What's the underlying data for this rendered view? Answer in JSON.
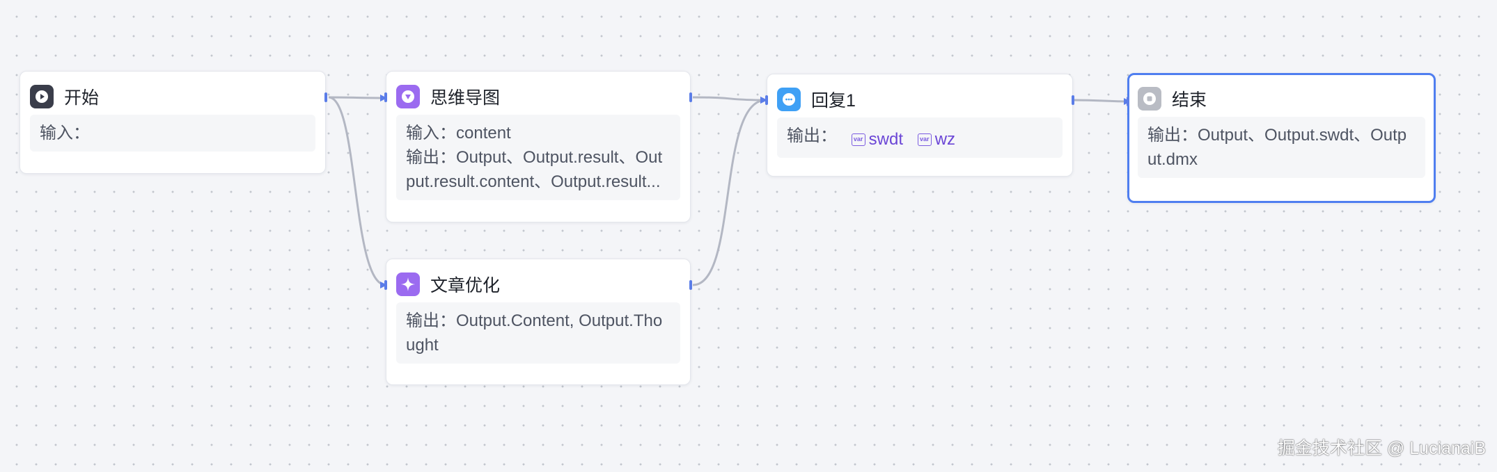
{
  "nodes": {
    "start": {
      "title": "开始",
      "input_label": "输入：",
      "input_value": ""
    },
    "mindmap": {
      "title": "思维导图",
      "input_label": "输入：",
      "input_value": "content",
      "output_label": "输出：",
      "output_value": "Output、Output.result、Output.result.content、Output.result..."
    },
    "article": {
      "title": "文章优化",
      "output_label": "输出：",
      "output_value": "Output.Content, Output.Thought"
    },
    "reply": {
      "title": "回复1",
      "output_label": "输出：",
      "var_tag_text": "var",
      "vars": [
        "swdt",
        "wz"
      ]
    },
    "end": {
      "title": "结束",
      "output_label": "输出：",
      "output_value": "Output、Output.swdt、Output.dmx"
    }
  },
  "watermark": "掘金技术社区 @ LucianaiB",
  "colors": {
    "start_icon": "#3a3d4a",
    "mindmap_icon": "#9b6bf0",
    "article_icon": "#9b6bf0",
    "reply_icon": "#3fa0f5",
    "end_icon": "#b9bcc4",
    "edge": "#b3b7c3",
    "arrow": "#5b7de8",
    "selected_border": "#4f7ef0"
  },
  "icons": {
    "start": "play-icon",
    "mindmap": "mindmap-icon",
    "article": "sparkle-icon",
    "reply": "chat-bubble-icon",
    "end": "stop-icon"
  }
}
